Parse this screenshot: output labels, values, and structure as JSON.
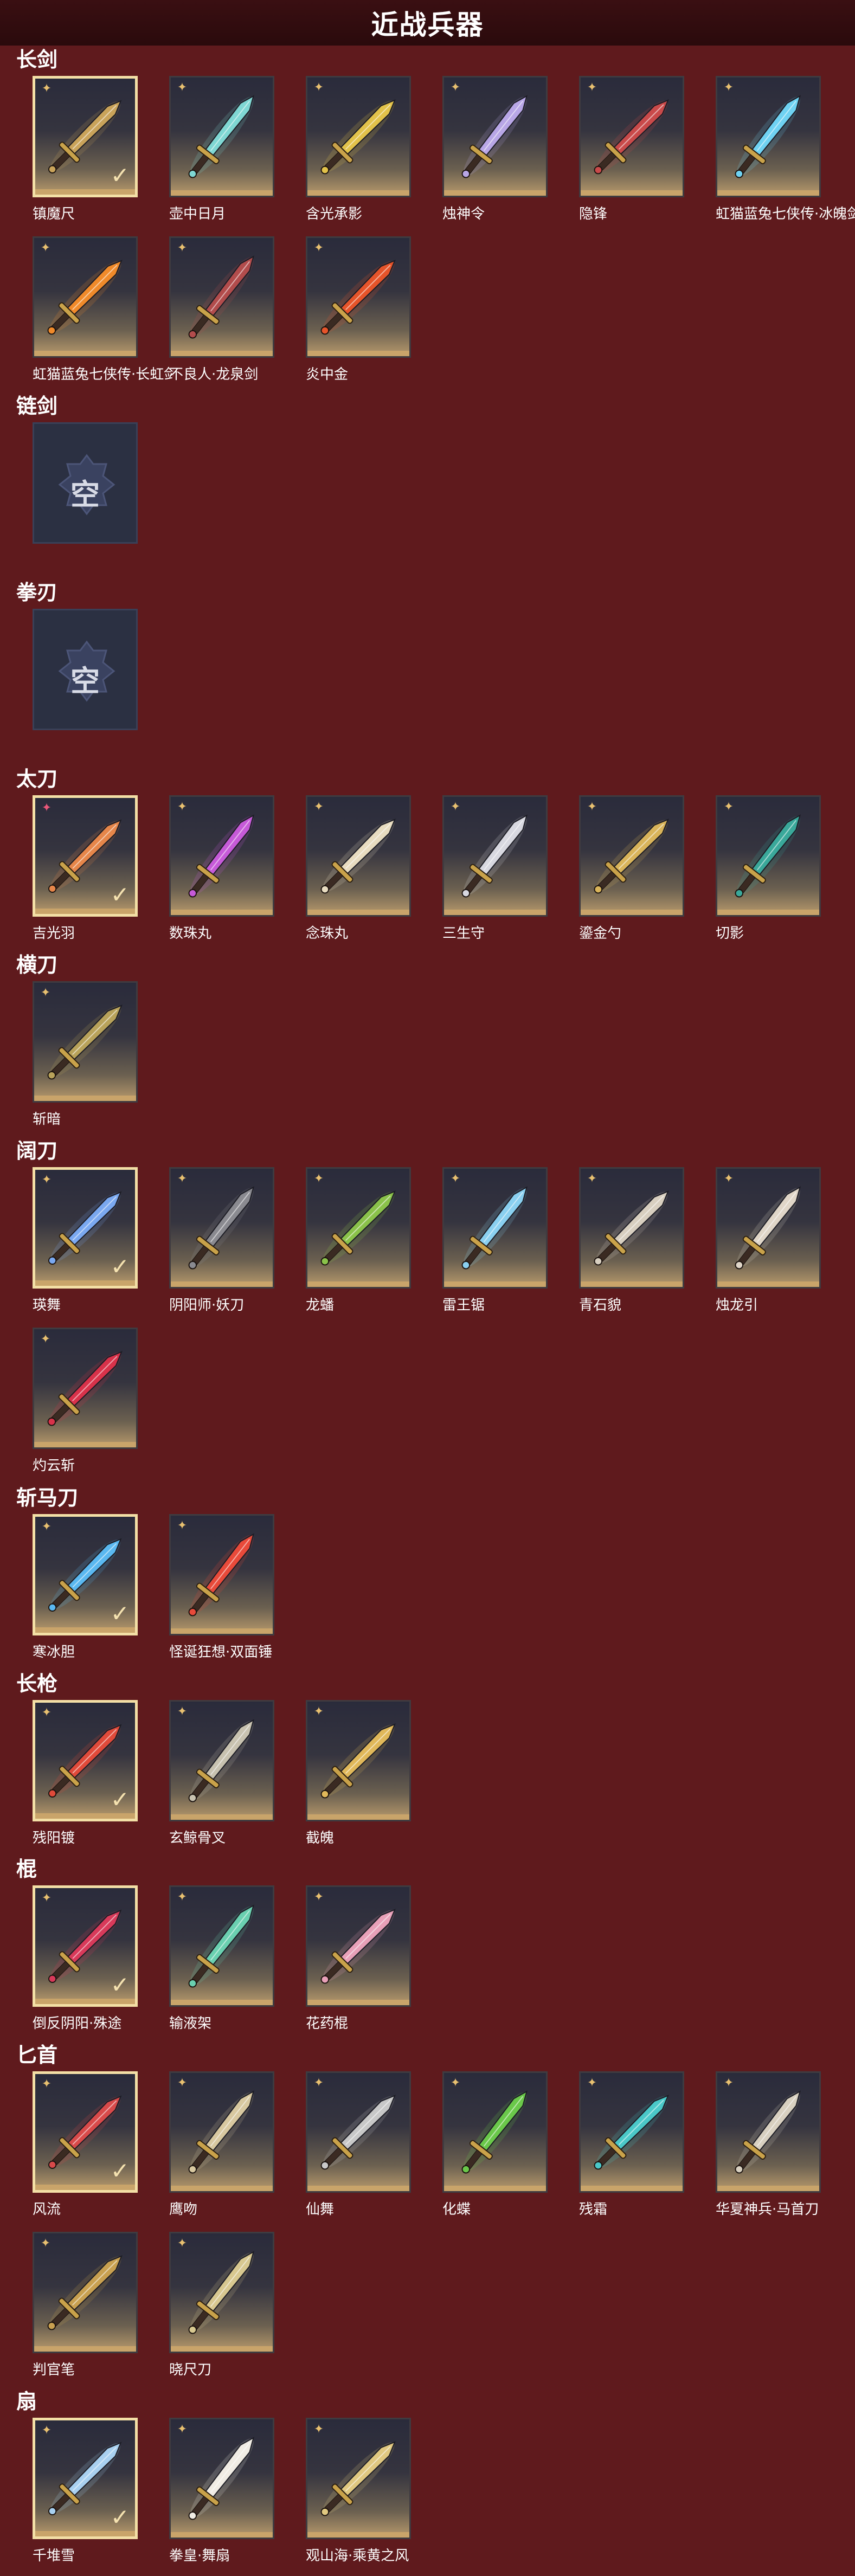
{
  "title": "近战兵器",
  "empty_label": "空",
  "colors": {
    "background": "#5f1a1d",
    "title_bar": "#2a0a0c",
    "rarity_gold": "#e8c070",
    "rarity_pink": "#e9577a",
    "selected_border": "#f3dfa6"
  },
  "sections": [
    {
      "title": "长剑",
      "items": [
        {
          "name": "镇魔尺",
          "selected": true,
          "rarity": "gold",
          "icon": "ornate-dark-sword",
          "tint": "#c9a35a"
        },
        {
          "name": "壶中日月",
          "selected": false,
          "rarity": "gold",
          "icon": "cyan-broad-sword",
          "tint": "#7fd7d3"
        },
        {
          "name": "含光承影",
          "selected": false,
          "rarity": "gold",
          "icon": "golden-sword",
          "tint": "#e2c24a"
        },
        {
          "name": "烛神令",
          "selected": false,
          "rarity": "gold",
          "icon": "violet-curved-sword",
          "tint": "#b8a6e6"
        },
        {
          "name": "隐锋",
          "selected": false,
          "rarity": "gold",
          "icon": "red-hilt-sword",
          "tint": "#c94a4a"
        },
        {
          "name": "虹猫蓝兔七侠传·冰魄剑",
          "selected": false,
          "rarity": "gold",
          "icon": "ice-sword",
          "tint": "#6fd2f2"
        },
        {
          "name": "虹猫蓝兔七侠传·长虹剑",
          "selected": false,
          "rarity": "gold",
          "icon": "flame-sword",
          "tint": "#f08a2a"
        },
        {
          "name": "不良人·龙泉剑",
          "selected": false,
          "rarity": "gold",
          "icon": "dark-dragon-sword",
          "tint": "#b24c4c"
        },
        {
          "name": "炎中金",
          "selected": false,
          "rarity": "gold",
          "icon": "fire-sword",
          "tint": "#e6542a"
        }
      ]
    },
    {
      "title": "链剑",
      "empty": true,
      "items": []
    },
    {
      "title": "拳刃",
      "empty": true,
      "items": []
    },
    {
      "title": "太刀",
      "items": [
        {
          "name": "吉光羽",
          "selected": true,
          "rarity": "pink",
          "icon": "phoenix-katana",
          "tint": "#e6864a"
        },
        {
          "name": "数珠丸",
          "selected": false,
          "rarity": "gold",
          "icon": "purple-katana",
          "tint": "#c65ad8"
        },
        {
          "name": "念珠丸",
          "selected": false,
          "rarity": "gold",
          "icon": "white-gold-katana",
          "tint": "#e8dcc0"
        },
        {
          "name": "三生守",
          "selected": false,
          "rarity": "gold",
          "icon": "silver-katana",
          "tint": "#d8d8e0"
        },
        {
          "name": "鎏金勺",
          "selected": false,
          "rarity": "gold",
          "icon": "golden-spoon",
          "tint": "#d9b45a"
        },
        {
          "name": "切影",
          "selected": false,
          "rarity": "gold",
          "icon": "teal-katana",
          "tint": "#3aa89a"
        }
      ]
    },
    {
      "title": "横刀",
      "items": [
        {
          "name": "斩暗",
          "selected": false,
          "rarity": "gold",
          "icon": "bronze-saber",
          "tint": "#b8a25a"
        }
      ]
    },
    {
      "title": "阔刀",
      "items": [
        {
          "name": "瑛舞",
          "selected": true,
          "rarity": "gold",
          "icon": "blue-glaive",
          "tint": "#7aa8f0"
        },
        {
          "name": "阴阳师·妖刀",
          "selected": false,
          "rarity": "gold",
          "icon": "dark-broadblade",
          "tint": "#8a8a90"
        },
        {
          "name": "龙蟠",
          "selected": false,
          "rarity": "gold",
          "icon": "jade-broadblade",
          "tint": "#8ac24a"
        },
        {
          "name": "雷王锯",
          "selected": false,
          "rarity": "gold",
          "icon": "thunder-saw",
          "tint": "#8ad0f0"
        },
        {
          "name": "青石貌",
          "selected": false,
          "rarity": "gold",
          "icon": "stone-broadblade",
          "tint": "#d8cfc0"
        },
        {
          "name": "烛龙引",
          "selected": false,
          "rarity": "gold",
          "icon": "dragon-broadblade",
          "tint": "#e0d6c8"
        },
        {
          "name": "灼云斩",
          "selected": false,
          "rarity": "gold",
          "icon": "crimson-broadblade",
          "tint": "#d8324a"
        }
      ]
    },
    {
      "title": "斩马刀",
      "items": [
        {
          "name": "寒冰胆",
          "selected": true,
          "rarity": "gold",
          "icon": "frost-greatsword",
          "tint": "#5ab8f0"
        },
        {
          "name": "怪诞狂想·双面锤",
          "selected": false,
          "rarity": "gold",
          "icon": "clown-hammer",
          "tint": "#e84a3a"
        }
      ]
    },
    {
      "title": "长枪",
      "items": [
        {
          "name": "残阳镀",
          "selected": true,
          "rarity": "gold",
          "icon": "red-spear",
          "tint": "#e04a3a"
        },
        {
          "name": "玄鲸骨叉",
          "selected": false,
          "rarity": "gold",
          "icon": "bone-trident",
          "tint": "#c8c2b0"
        },
        {
          "name": "截魄",
          "selected": false,
          "rarity": "gold",
          "icon": "golden-spear",
          "tint": "#e0b85a"
        }
      ]
    },
    {
      "title": "棍",
      "items": [
        {
          "name": "倒反阴阳·殊途",
          "selected": true,
          "rarity": "gold",
          "icon": "crimson-staff",
          "tint": "#d83a5a"
        },
        {
          "name": "输液架",
          "selected": false,
          "rarity": "gold",
          "icon": "iv-stand-staff",
          "tint": "#6ad0b0"
        },
        {
          "name": "花药棍",
          "selected": false,
          "rarity": "gold",
          "icon": "blossom-staff",
          "tint": "#e8a0b8"
        }
      ]
    },
    {
      "title": "匕首",
      "items": [
        {
          "name": "风流",
          "selected": true,
          "rarity": "gold",
          "icon": "red-tip-dagger",
          "tint": "#d84a4a"
        },
        {
          "name": "鹰吻",
          "selected": false,
          "rarity": "gold",
          "icon": "curved-dagger",
          "tint": "#d8c8a0"
        },
        {
          "name": "仙舞",
          "selected": false,
          "rarity": "gold",
          "icon": "dancing-dagger",
          "tint": "#c8c8c8"
        },
        {
          "name": "化蝶",
          "selected": false,
          "rarity": "gold",
          "icon": "jade-kris",
          "tint": "#6ac84a"
        },
        {
          "name": "残霜",
          "selected": false,
          "rarity": "gold",
          "icon": "frost-dagger",
          "tint": "#4ac8c8"
        },
        {
          "name": "华夏神兵·马首刀",
          "selected": false,
          "rarity": "gold",
          "icon": "horse-head-dagger",
          "tint": "#d8d0c0"
        },
        {
          "name": "判官笔",
          "selected": false,
          "rarity": "gold",
          "icon": "judge-brush",
          "tint": "#c8a050"
        },
        {
          "name": "晓尺刀",
          "selected": false,
          "rarity": "gold",
          "icon": "dawn-dagger",
          "tint": "#d8c890"
        }
      ]
    },
    {
      "title": "扇",
      "items": [
        {
          "name": "千堆雪",
          "selected": true,
          "rarity": "gold",
          "icon": "snow-fan",
          "tint": "#a8d0f0"
        },
        {
          "name": "拳皇·舞扇",
          "selected": false,
          "rarity": "gold",
          "icon": "white-fan",
          "tint": "#f0ece4"
        },
        {
          "name": "观山海·乘黄之风",
          "selected": false,
          "rarity": "gold",
          "icon": "golden-fan",
          "tint": "#e0c880"
        }
      ]
    }
  ]
}
